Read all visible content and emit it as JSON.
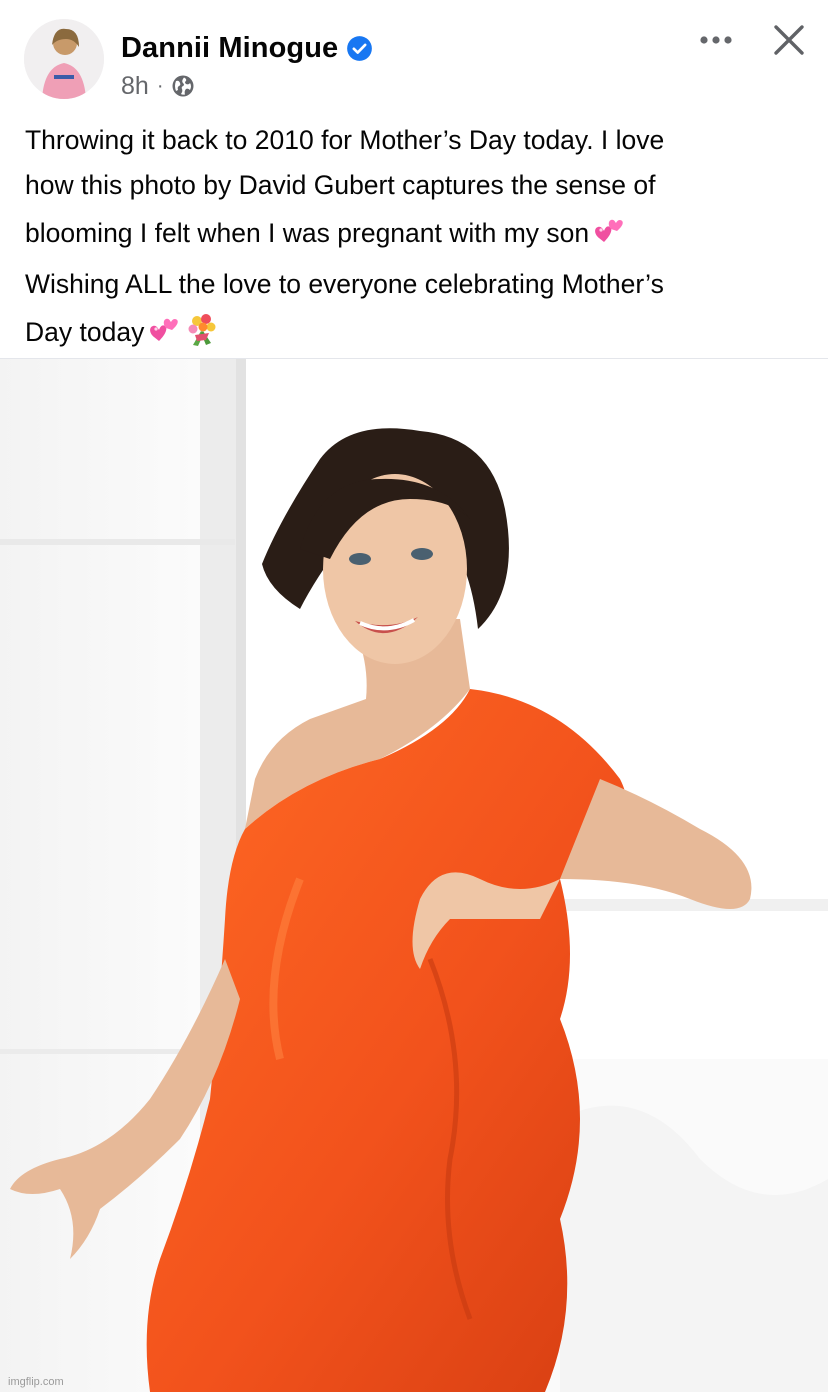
{
  "post": {
    "author": "Dannii Minogue",
    "verified_icon": "verified-badge-icon",
    "time": "8h",
    "separator": "·",
    "audience_icon": "globe-icon",
    "caption_lines": [
      "Throwing it back to 2010 for Mother’s Day today. I love",
      "how this photo by David Gubert captures the sense of",
      "blooming I felt when I was pregnant with my son",
      "Wishing ALL the love to everyone celebrating Mother’s",
      "Day today"
    ],
    "emoji": [
      "two-hearts-icon",
      "two-hearts-icon",
      "bouquet-icon"
    ]
  },
  "header_actions": {
    "more_icon": "more-options-icon",
    "close_icon": "close-icon"
  },
  "photo": {
    "description_icon": "post-photo",
    "dress_color": "#f2521c"
  },
  "watermark": "imgflip.com",
  "colors": {
    "verified_blue": "#1877f2",
    "secondary_text": "#65676b"
  }
}
